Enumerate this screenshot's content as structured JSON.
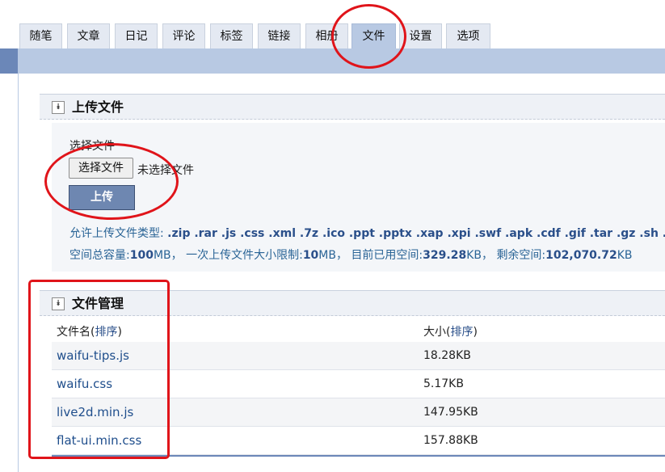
{
  "tabs": [
    "随笔",
    "文章",
    "日记",
    "评论",
    "标签",
    "链接",
    "相册",
    "文件",
    "设置",
    "选项"
  ],
  "active_tab": "文件",
  "upload": {
    "section_title": "上传文件",
    "choose_label": "选择文件",
    "choose_button": "选择文件",
    "no_file_text": "未选择文件",
    "upload_button": "上传",
    "allowed_label": "允许上传文件类型:",
    "allowed_types": ".zip .rar .js .css .xml .7z .ico .ppt .pptx .xap .xpi .swf .apk .cdf .gif .tar .gz .sh .bmp",
    "quota": {
      "total_label": "空间总容量:",
      "total_value": "100",
      "total_unit": "MB，",
      "single_label": "一次上传文件大小限制:",
      "single_value": "10",
      "single_unit": "MB，",
      "used_label": "目前已用空间:",
      "used_value": "329.28",
      "used_unit": "KB，",
      "remaining_label": "剩余空间:",
      "remaining_value": "102,070.72",
      "remaining_unit": "KB"
    }
  },
  "files": {
    "section_title": "文件管理",
    "col_name_prefix": "文件名(",
    "col_size_prefix": "大小(",
    "sort_label": "排序",
    "col_suffix": ")",
    "rows": [
      {
        "name": "waifu-tips.js",
        "size": "18.28KB"
      },
      {
        "name": "waifu.css",
        "size": "5.17KB"
      },
      {
        "name": "live2d.min.js",
        "size": "147.95KB"
      },
      {
        "name": "flat-ui.min.css",
        "size": "157.88KB"
      }
    ]
  },
  "colors": {
    "tab_active": "#b8c9e3",
    "band": "#b8c9e3",
    "upload_button": "#6e87b1",
    "link": "#1f4e8c",
    "annotation": "#e0141a"
  },
  "icons": {
    "section_toggle": "double-chevron-down-icon"
  }
}
